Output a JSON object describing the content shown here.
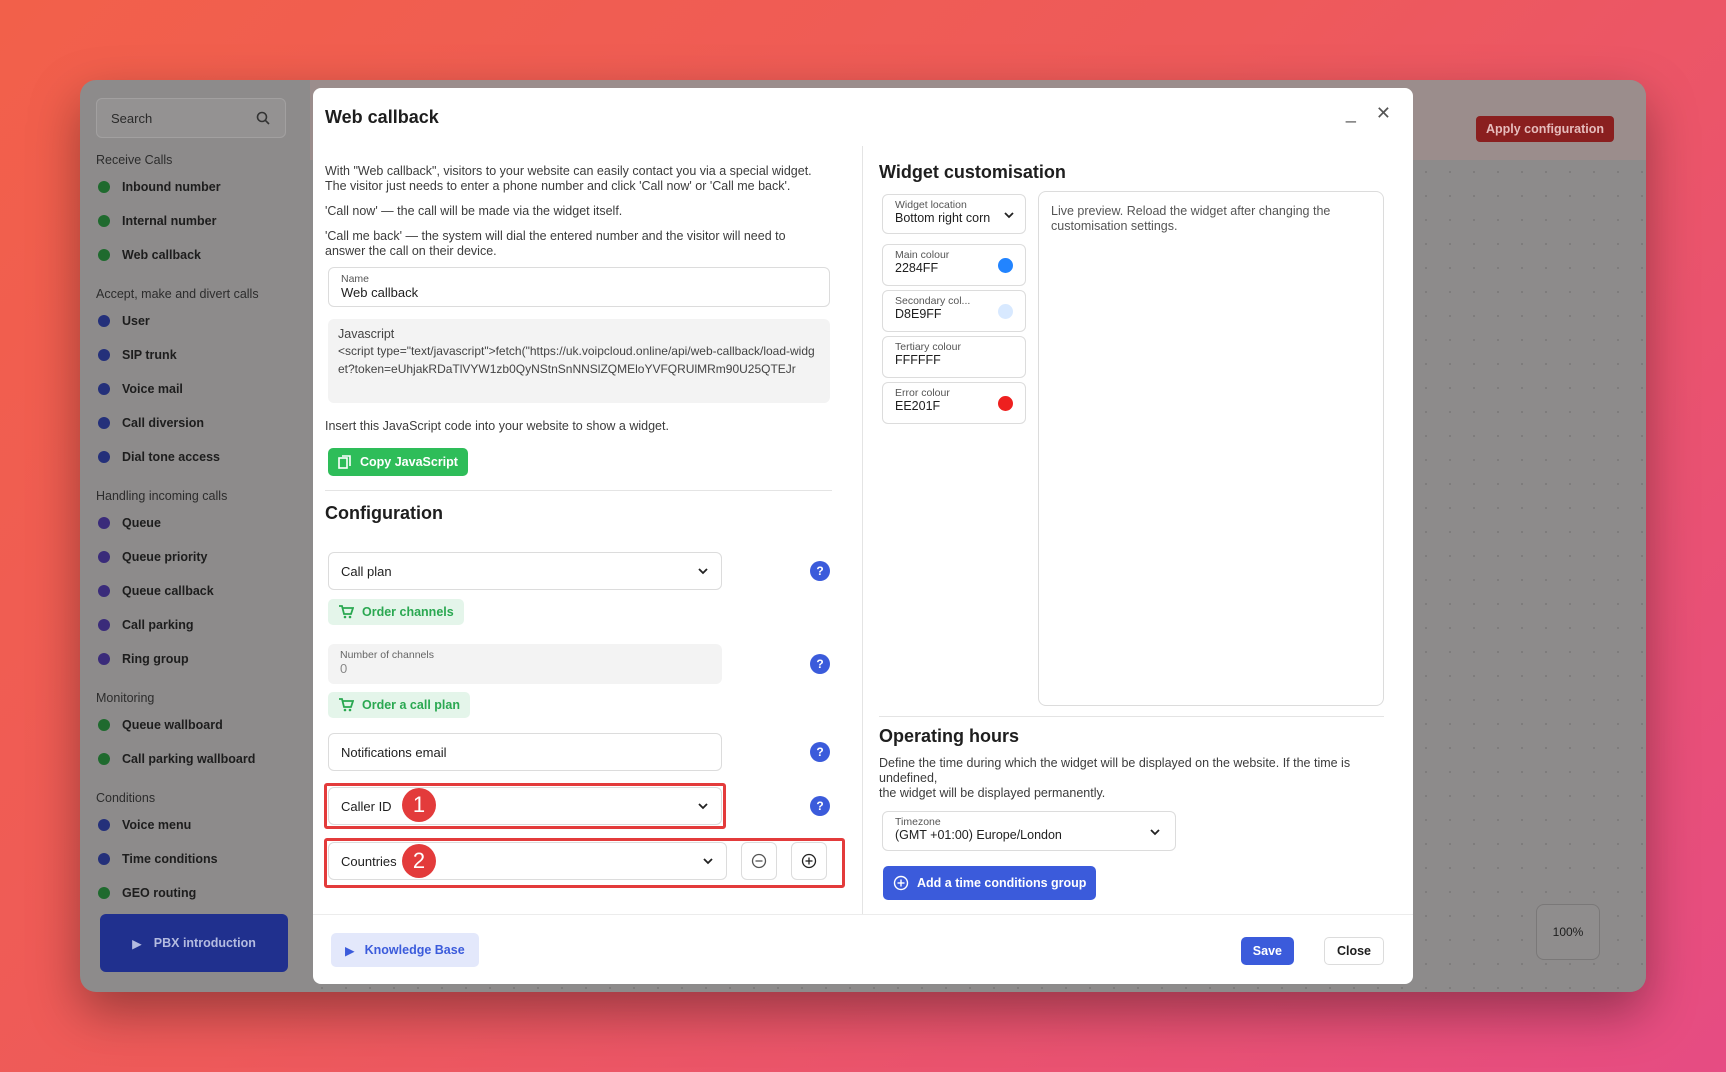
{
  "app": {
    "search_placeholder": "Search",
    "apply_label": "Apply configuration",
    "zoom": "100%",
    "pbx_label": "PBX introduction",
    "groups": [
      {
        "title": "Receive Calls",
        "items": [
          {
            "label": "Inbound number",
            "icon": "inbound-number-icon"
          },
          {
            "label": "Internal number",
            "icon": "internal-number-icon"
          },
          {
            "label": "Web callback",
            "icon": "web-callback-icon"
          }
        ]
      },
      {
        "title": "Accept, make and divert calls",
        "items": [
          {
            "label": "User",
            "icon": "user-icon"
          },
          {
            "label": "SIP trunk",
            "icon": "sip-trunk-icon"
          },
          {
            "label": "Voice mail",
            "icon": "voicemail-icon"
          },
          {
            "label": "Call diversion",
            "icon": "call-diversion-icon"
          },
          {
            "label": "Dial tone access",
            "icon": "lock-icon"
          }
        ]
      },
      {
        "title": "Handling incoming calls",
        "items": [
          {
            "label": "Queue",
            "icon": "queue-icon"
          },
          {
            "label": "Queue priority",
            "icon": "arrow-up-icon"
          },
          {
            "label": "Queue callback",
            "icon": "queue-callback-icon"
          },
          {
            "label": "Call parking",
            "icon": "parking-icon"
          },
          {
            "label": "Ring group",
            "icon": "ring-group-icon"
          }
        ]
      },
      {
        "title": "Monitoring",
        "items": [
          {
            "label": "Queue wallboard",
            "icon": "wallboard-icon"
          },
          {
            "label": "Call parking wallboard",
            "icon": "wallboard-icon"
          }
        ]
      },
      {
        "title": "Conditions",
        "items": [
          {
            "label": "Voice menu",
            "icon": "voice-menu-icon"
          },
          {
            "label": "Time conditions",
            "icon": "clock-icon"
          },
          {
            "label": "GEO routing",
            "icon": "geo-routing-icon"
          }
        ]
      }
    ]
  },
  "modal": {
    "title": "Web callback",
    "intro1": "With \"Web callback\", visitors to your website can easily contact you via a special widget. The visitor just needs to enter a phone number and click 'Call now' or 'Call me back'.",
    "intro2": "'Call now' — the call will be made via the widget itself.",
    "intro3": "'Call me back' — the system will dial the entered number and the visitor will need to answer the call on their device.",
    "name_label": "Name",
    "name_value": "Web callback",
    "js_label": "Javascript",
    "js_code": "<script type=\"text/javascript\">fetch(\"https://uk.voipcloud.online/api/web-callback/load-widget?token=eUhjakRDaTlVYW1zb0QyNStnSnNNSlZQMEloYVFQRUlMRm90U25QTEJr",
    "insert_note": "Insert this JavaScript code into your website to show a widget.",
    "copy_js": "Copy JavaScript",
    "config_title": "Configuration",
    "call_plan": "Call plan",
    "order_channels": "Order channels",
    "channels_label": "Number of channels",
    "channels_value": "0",
    "order_plan": "Order a call plan",
    "notifications_email": "Notifications email",
    "caller_id": "Caller ID",
    "countries": "Countries",
    "marker1": "1",
    "marker2": "2",
    "help": "?",
    "widget_title": "Widget customisation",
    "widget_location_label": "Widget location",
    "widget_location_value": "Bottom right corn",
    "colors": [
      {
        "label": "Main colour",
        "value": "2284FF",
        "swatch": "#2284FF"
      },
      {
        "label": "Secondary col...",
        "value": "D8E9FF",
        "swatch": "#D8E9FF"
      },
      {
        "label": "Tertiary colour",
        "value": "FFFFFF",
        "swatch": ""
      },
      {
        "label": "Error colour",
        "value": "EE201F",
        "swatch": "#EE201F"
      }
    ],
    "preview_text": "Live preview. Reload the widget after changing the customisation settings.",
    "hours_title": "Operating hours",
    "hours_desc1": "Define the time during which the widget will be displayed on the website. If the time is undefined,",
    "hours_desc2": "the widget will be displayed permanently.",
    "timezone_label": "Timezone",
    "timezone_value": "(GMT +01:00) Europe/London",
    "add_group": "Add a time conditions group",
    "kb_label": "Knowledge Base",
    "save_label": "Save",
    "close_label": "Close"
  }
}
